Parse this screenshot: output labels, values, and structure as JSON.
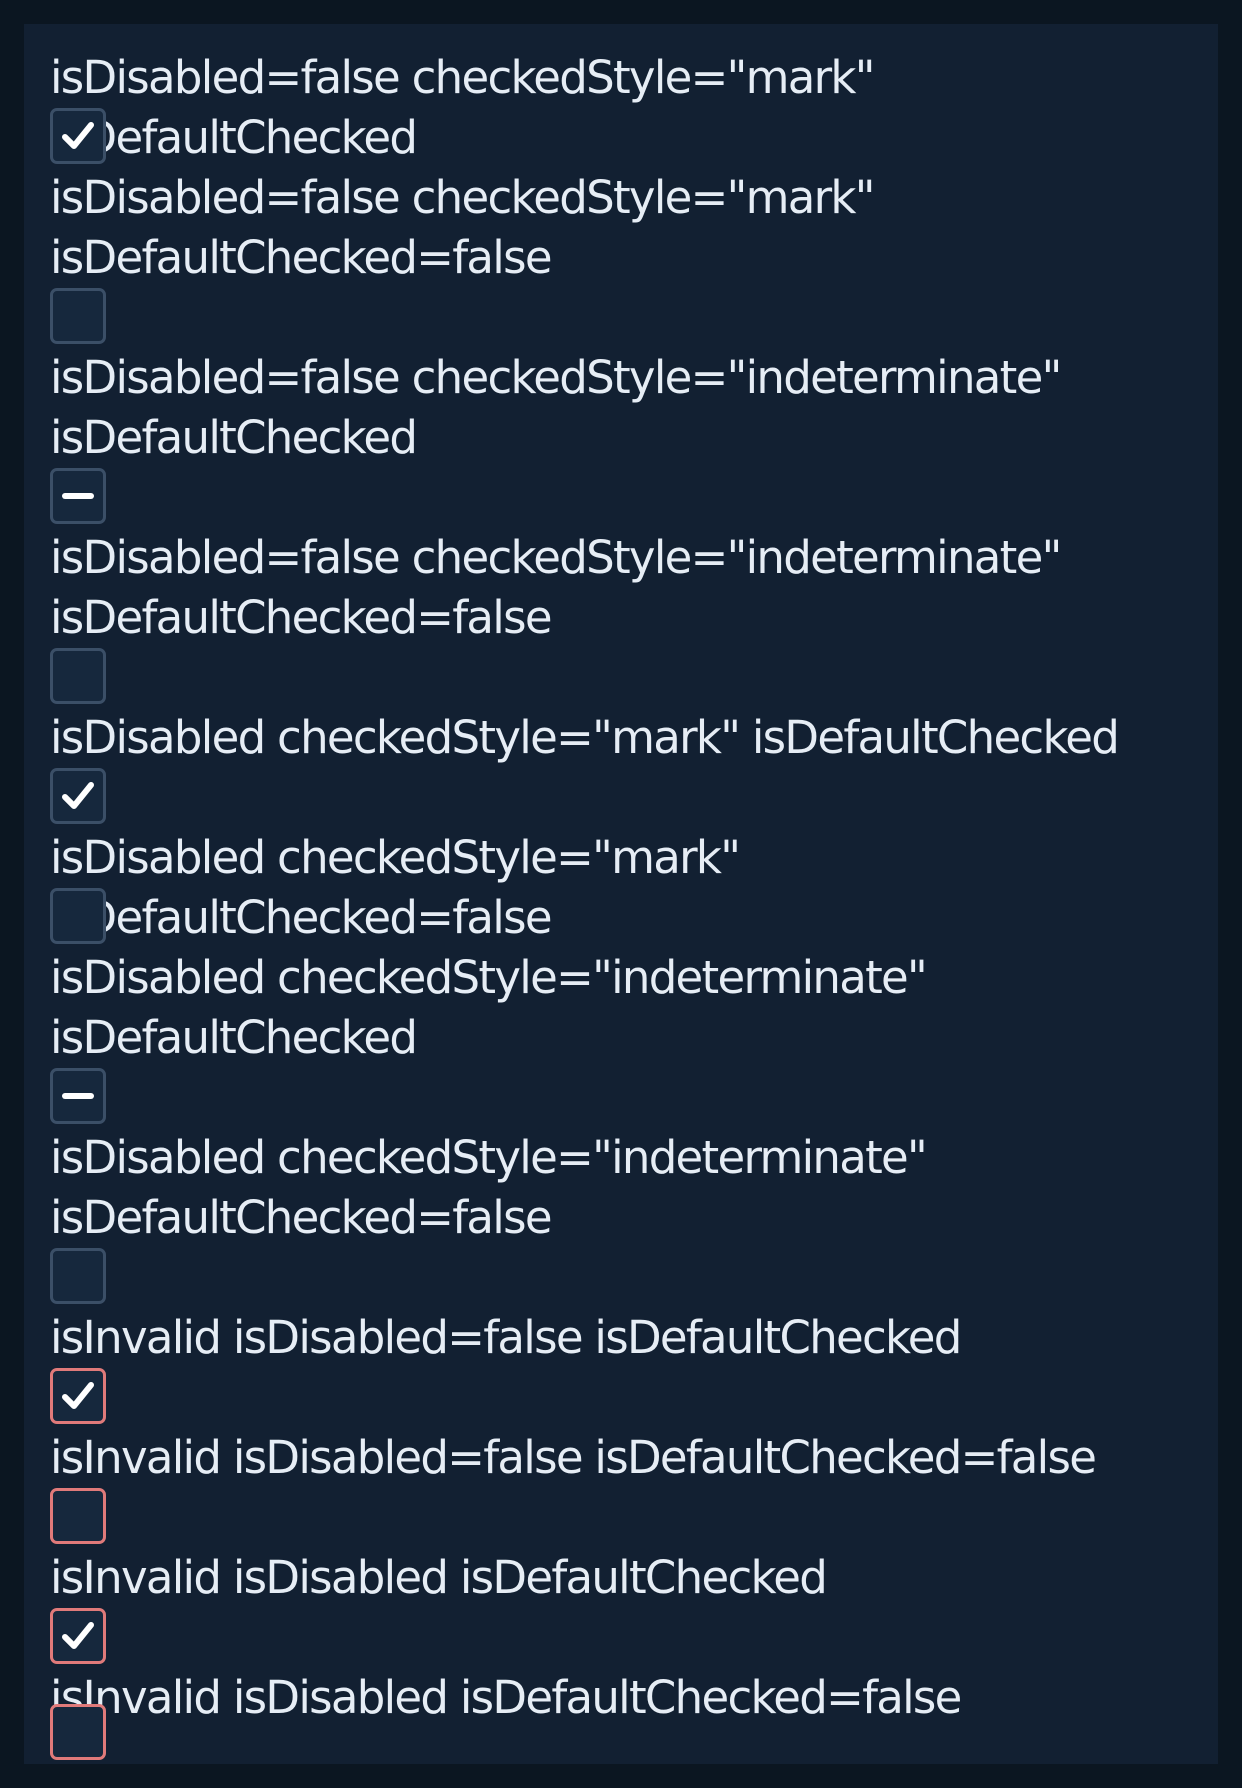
{
  "colors": {
    "page_background": "#0b1621",
    "panel_background": "#122032",
    "text": "#e6edf5",
    "checkbox_border": "#3b4f67",
    "checkbox_fill": "#16283d",
    "invalid_border": "#e07a7a",
    "mark": "#ffffff"
  },
  "items": [
    {
      "label": "isDisabled=false checkedStyle=\"mark\" isDefaultChecked",
      "state": "checked",
      "icon": "check-icon",
      "invalid": false
    },
    {
      "label": "isDisabled=false checkedStyle=\"mark\" isDefaultChecked=false",
      "state": "unchecked",
      "icon": "",
      "invalid": false
    },
    {
      "label": "isDisabled=false checkedStyle=\"indeterminate\" isDefaultChecked",
      "state": "indeterminate",
      "icon": "minus-icon",
      "invalid": false
    },
    {
      "label": "isDisabled=false checkedStyle=\"indeterminate\" isDefaultChecked=false",
      "state": "unchecked",
      "icon": "",
      "invalid": false
    },
    {
      "label": "isDisabled checkedStyle=\"mark\" isDefaultChecked",
      "state": "checked",
      "icon": "check-icon",
      "invalid": false
    },
    {
      "label": "isDisabled checkedStyle=\"mark\" isDefaultChecked=false",
      "state": "unchecked",
      "icon": "",
      "invalid": false
    },
    {
      "label": "isDisabled checkedStyle=\"indeterminate\" isDefaultChecked",
      "state": "indeterminate",
      "icon": "minus-icon",
      "invalid": false
    },
    {
      "label": "isDisabled checkedStyle=\"indeterminate\" isDefaultChecked=false",
      "state": "unchecked",
      "icon": "",
      "invalid": false
    },
    {
      "label": "isInvalid isDisabled=false isDefaultChecked",
      "state": "checked",
      "icon": "check-icon",
      "invalid": true
    },
    {
      "label": "isInvalid isDisabled=false isDefaultChecked=false",
      "state": "unchecked",
      "icon": "",
      "invalid": true
    },
    {
      "label": "isInvalid isDisabled isDefaultChecked",
      "state": "checked",
      "icon": "check-icon",
      "invalid": true
    },
    {
      "label": "isInvalid isDisabled isDefaultChecked=false",
      "state": "unchecked",
      "icon": "",
      "invalid": true
    }
  ]
}
